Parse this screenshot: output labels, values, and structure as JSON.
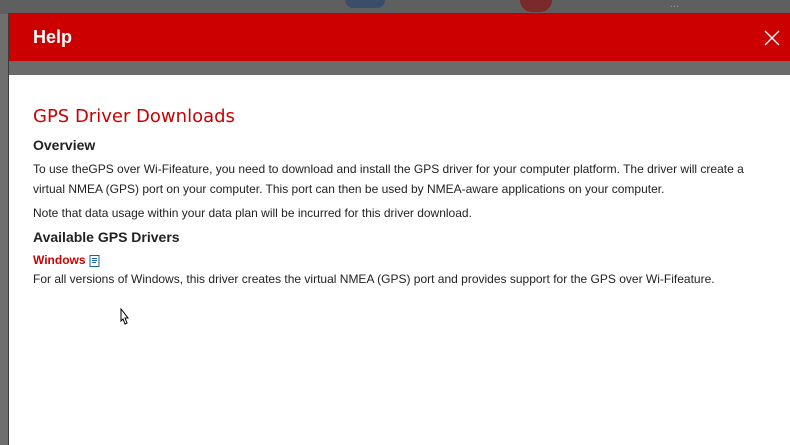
{
  "background": {
    "text": "..."
  },
  "dialog": {
    "title": "Help",
    "close_icon": "close-icon",
    "heading": "GPS Driver Downloads",
    "overview_label": "Overview",
    "overview_text": "To use theGPS over Wi-Fifeature, you need to download and install the GPS driver for your computer platform. The driver will create a virtual NMEA (GPS) port on your computer. This port can then be used by NMEA-aware applications on your computer.",
    "note_text": "Note that data usage within your data plan will be incurred for this driver download.",
    "drivers_label": "Available GPS Drivers",
    "windows_link": "Windows",
    "windows_desc": "For all versions of Windows, this driver creates the virtual NMEA (GPS) port and provides support for the GPS over Wi-Fifeature."
  },
  "colors": {
    "titlebar": "#cc0000",
    "link": "#cc0000",
    "heading": "#cc0000"
  }
}
